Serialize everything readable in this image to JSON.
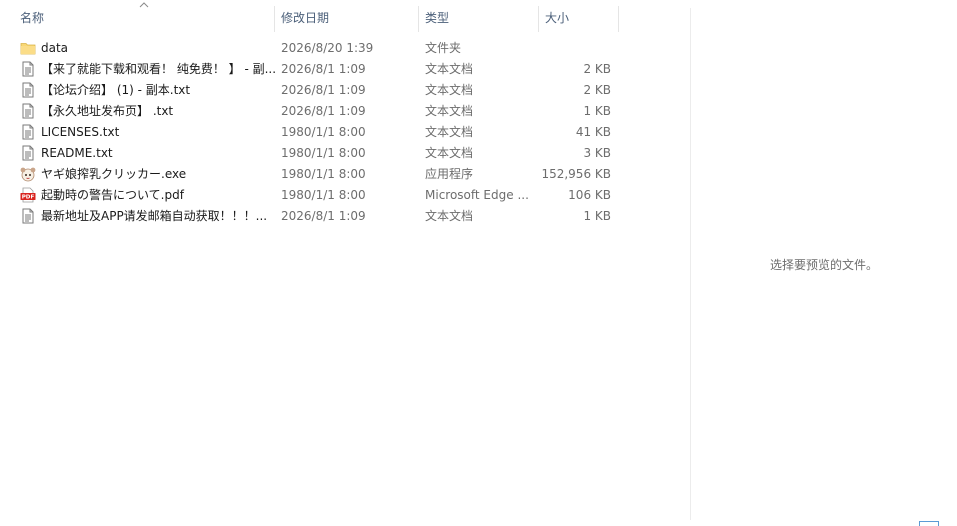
{
  "columns": {
    "name": "名称",
    "date": "修改日期",
    "type": "类型",
    "size": "大小"
  },
  "sort": {
    "column": "name",
    "direction": "ascending"
  },
  "files": [
    {
      "name": "data",
      "date": "2026/8/20 1:39",
      "type": "文件夹",
      "size": "",
      "icon": "folder-icon"
    },
    {
      "name": "【来了就能下载和观看！ 纯免费！ 】 - 副...",
      "date": "2026/8/1 1:09",
      "type": "文本文档",
      "size": "2 KB",
      "icon": "text-file-icon"
    },
    {
      "name": "【论坛介绍】  (1) - 副本.txt",
      "date": "2026/8/1 1:09",
      "type": "文本文档",
      "size": "2 KB",
      "icon": "text-file-icon"
    },
    {
      "name": "【永久地址发布页】 .txt",
      "date": "2026/8/1 1:09",
      "type": "文本文档",
      "size": "1 KB",
      "icon": "text-file-icon"
    },
    {
      "name": "LICENSES.txt",
      "date": "1980/1/1 8:00",
      "type": "文本文档",
      "size": "41 KB",
      "icon": "text-file-icon"
    },
    {
      "name": "README.txt",
      "date": "1980/1/1 8:00",
      "type": "文本文档",
      "size": "3 KB",
      "icon": "text-file-icon"
    },
    {
      "name": "ヤギ娘搾乳クリッカー.exe",
      "date": "1980/1/1 8:00",
      "type": "应用程序",
      "size": "152,956 KB",
      "icon": "app-exe-icon"
    },
    {
      "name": "起動時の警告について.pdf",
      "date": "1980/1/1 8:00",
      "type": "Microsoft Edge ...",
      "size": "106 KB",
      "icon": "pdf-file-icon"
    },
    {
      "name": "最新地址及APP请发邮箱自动获取！！！...",
      "date": "2026/8/1 1:09",
      "type": "文本文档",
      "size": "1 KB",
      "icon": "text-file-icon"
    }
  ],
  "preview": {
    "message": "选择要预览的文件。"
  },
  "colors": {
    "header_text": "#4c607a",
    "folder": "#f8d775",
    "pdf": "#d9241f"
  }
}
